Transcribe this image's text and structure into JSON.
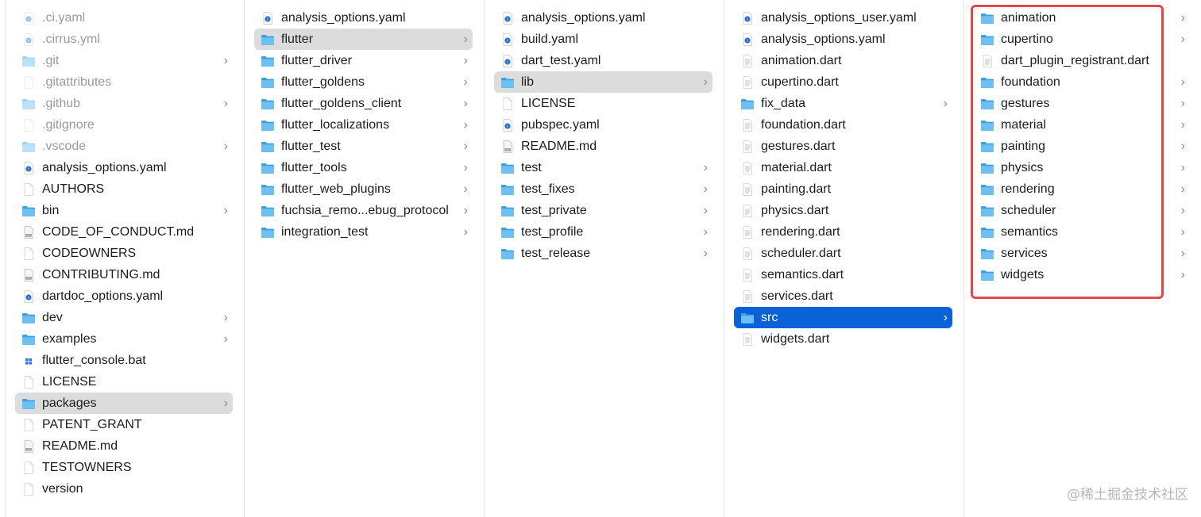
{
  "columns": [
    {
      "items": [
        {
          "name": ".ci.yaml",
          "icon": "yaml-file-icon",
          "folder": false,
          "dim": true
        },
        {
          "name": ".cirrus.yml",
          "icon": "yaml-file-icon",
          "folder": false,
          "dim": true
        },
        {
          "name": ".git",
          "icon": "folder-icon",
          "folder": true,
          "dim": true
        },
        {
          "name": ".gitattributes",
          "icon": "blank-file-icon",
          "folder": false,
          "dim": true
        },
        {
          "name": ".github",
          "icon": "folder-icon",
          "folder": true,
          "dim": true
        },
        {
          "name": ".gitignore",
          "icon": "blank-file-icon",
          "folder": false,
          "dim": true
        },
        {
          "name": ".vscode",
          "icon": "folder-icon",
          "folder": true,
          "dim": true
        },
        {
          "name": "analysis_options.yaml",
          "icon": "yaml-file-icon",
          "folder": false
        },
        {
          "name": "AUTHORS",
          "icon": "blank-file-icon",
          "folder": false
        },
        {
          "name": "bin",
          "icon": "folder-icon",
          "folder": true
        },
        {
          "name": "CODE_OF_CONDUCT.md",
          "icon": "markdown-file-icon",
          "folder": false
        },
        {
          "name": "CODEOWNERS",
          "icon": "blank-file-icon",
          "folder": false
        },
        {
          "name": "CONTRIBUTING.md",
          "icon": "markdown-file-icon",
          "folder": false
        },
        {
          "name": "dartdoc_options.yaml",
          "icon": "yaml-file-icon",
          "folder": false
        },
        {
          "name": "dev",
          "icon": "folder-icon",
          "folder": true
        },
        {
          "name": "examples",
          "icon": "folder-icon",
          "folder": true
        },
        {
          "name": "flutter_console.bat",
          "icon": "bat-file-icon",
          "folder": false
        },
        {
          "name": "LICENSE",
          "icon": "blank-file-icon",
          "folder": false
        },
        {
          "name": "packages",
          "icon": "folder-icon",
          "folder": true,
          "selected": "gray"
        },
        {
          "name": "PATENT_GRANT",
          "icon": "blank-file-icon",
          "folder": false
        },
        {
          "name": "README.md",
          "icon": "markdown-file-icon",
          "folder": false
        },
        {
          "name": "TESTOWNERS",
          "icon": "blank-file-icon",
          "folder": false
        },
        {
          "name": "version",
          "icon": "blank-file-icon",
          "folder": false
        }
      ]
    },
    {
      "items": [
        {
          "name": "analysis_options.yaml",
          "icon": "yaml-file-icon",
          "folder": false
        },
        {
          "name": "flutter",
          "icon": "folder-icon",
          "folder": true,
          "selected": "gray"
        },
        {
          "name": "flutter_driver",
          "icon": "folder-icon",
          "folder": true
        },
        {
          "name": "flutter_goldens",
          "icon": "folder-icon",
          "folder": true
        },
        {
          "name": "flutter_goldens_client",
          "icon": "folder-icon",
          "folder": true
        },
        {
          "name": "flutter_localizations",
          "icon": "folder-icon",
          "folder": true
        },
        {
          "name": "flutter_test",
          "icon": "folder-icon",
          "folder": true
        },
        {
          "name": "flutter_tools",
          "icon": "folder-icon",
          "folder": true
        },
        {
          "name": "flutter_web_plugins",
          "icon": "folder-icon",
          "folder": true
        },
        {
          "name": "fuchsia_remo...ebug_protocol",
          "icon": "folder-icon",
          "folder": true
        },
        {
          "name": "integration_test",
          "icon": "folder-icon",
          "folder": true
        }
      ]
    },
    {
      "items": [
        {
          "name": "analysis_options.yaml",
          "icon": "yaml-file-icon",
          "folder": false
        },
        {
          "name": "build.yaml",
          "icon": "yaml-file-icon",
          "folder": false
        },
        {
          "name": "dart_test.yaml",
          "icon": "yaml-file-icon",
          "folder": false
        },
        {
          "name": "lib",
          "icon": "folder-icon",
          "folder": true,
          "selected": "gray"
        },
        {
          "name": "LICENSE",
          "icon": "blank-file-icon",
          "folder": false
        },
        {
          "name": "pubspec.yaml",
          "icon": "yaml-file-icon",
          "folder": false
        },
        {
          "name": "README.md",
          "icon": "markdown-file-icon",
          "folder": false
        },
        {
          "name": "test",
          "icon": "folder-icon",
          "folder": true
        },
        {
          "name": "test_fixes",
          "icon": "folder-icon",
          "folder": true
        },
        {
          "name": "test_private",
          "icon": "folder-icon",
          "folder": true
        },
        {
          "name": "test_profile",
          "icon": "folder-icon",
          "folder": true
        },
        {
          "name": "test_release",
          "icon": "folder-icon",
          "folder": true
        }
      ]
    },
    {
      "items": [
        {
          "name": "analysis_options_user.yaml",
          "icon": "yaml-file-icon",
          "folder": false
        },
        {
          "name": "analysis_options.yaml",
          "icon": "yaml-file-icon",
          "folder": false
        },
        {
          "name": "animation.dart",
          "icon": "text-file-icon",
          "folder": false
        },
        {
          "name": "cupertino.dart",
          "icon": "text-file-icon",
          "folder": false
        },
        {
          "name": "fix_data",
          "icon": "folder-icon",
          "folder": true
        },
        {
          "name": "foundation.dart",
          "icon": "text-file-icon",
          "folder": false
        },
        {
          "name": "gestures.dart",
          "icon": "text-file-icon",
          "folder": false
        },
        {
          "name": "material.dart",
          "icon": "text-file-icon",
          "folder": false
        },
        {
          "name": "painting.dart",
          "icon": "text-file-icon",
          "folder": false
        },
        {
          "name": "physics.dart",
          "icon": "text-file-icon",
          "folder": false
        },
        {
          "name": "rendering.dart",
          "icon": "text-file-icon",
          "folder": false
        },
        {
          "name": "scheduler.dart",
          "icon": "text-file-icon",
          "folder": false
        },
        {
          "name": "semantics.dart",
          "icon": "text-file-icon",
          "folder": false
        },
        {
          "name": "services.dart",
          "icon": "text-file-icon",
          "folder": false
        },
        {
          "name": "src",
          "icon": "folder-icon",
          "folder": true,
          "selected": "blue"
        },
        {
          "name": "widgets.dart",
          "icon": "text-file-icon",
          "folder": false
        }
      ]
    },
    {
      "items": [
        {
          "name": "animation",
          "icon": "folder-icon",
          "folder": true
        },
        {
          "name": "cupertino",
          "icon": "folder-icon",
          "folder": true
        },
        {
          "name": "dart_plugin_registrant.dart",
          "icon": "text-file-icon",
          "folder": false
        },
        {
          "name": "foundation",
          "icon": "folder-icon",
          "folder": true
        },
        {
          "name": "gestures",
          "icon": "folder-icon",
          "folder": true
        },
        {
          "name": "material",
          "icon": "folder-icon",
          "folder": true
        },
        {
          "name": "painting",
          "icon": "folder-icon",
          "folder": true
        },
        {
          "name": "physics",
          "icon": "folder-icon",
          "folder": true
        },
        {
          "name": "rendering",
          "icon": "folder-icon",
          "folder": true
        },
        {
          "name": "scheduler",
          "icon": "folder-icon",
          "folder": true
        },
        {
          "name": "semantics",
          "icon": "folder-icon",
          "folder": true
        },
        {
          "name": "services",
          "icon": "folder-icon",
          "folder": true
        },
        {
          "name": "widgets",
          "icon": "folder-icon",
          "folder": true
        }
      ]
    }
  ],
  "chevron_glyph": "›",
  "watermark": "@稀土掘金技术社区",
  "colors": {
    "selection_gray": "#dcdcdc",
    "selection_blue": "#0a62d6",
    "folder": "#5db4ec",
    "annotation_box": "#e0484a"
  }
}
